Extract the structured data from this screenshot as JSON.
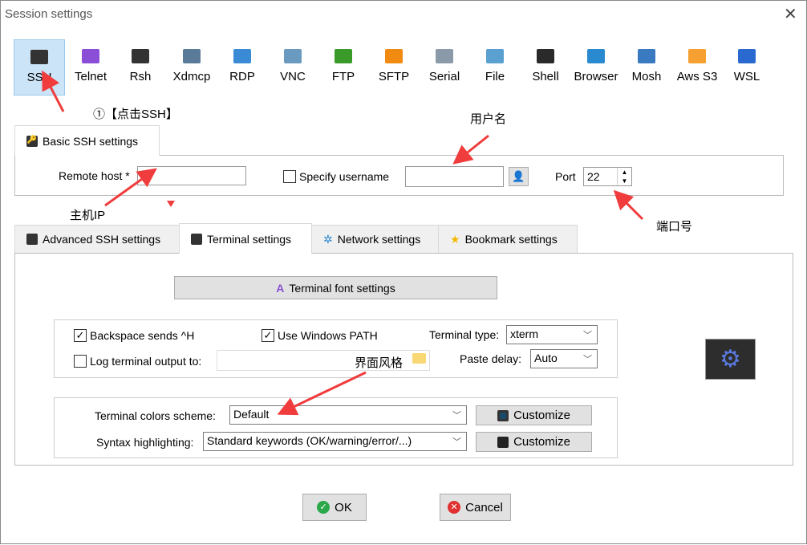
{
  "window": {
    "title": "Session settings",
    "close": "✕"
  },
  "protocols": [
    {
      "label": "SSH",
      "icon": "ssh-key-icon",
      "color": "#333",
      "selected": true
    },
    {
      "label": "Telnet",
      "icon": "telnet-gem-icon",
      "color": "#8a4fd6"
    },
    {
      "label": "Rsh",
      "icon": "rsh-gears-icon",
      "color": "#333"
    },
    {
      "label": "Xdmcp",
      "icon": "xdmcp-monitor-icon",
      "color": "#5a7a9a"
    },
    {
      "label": "RDP",
      "icon": "rdp-monitor-icon",
      "color": "#3a8ad6"
    },
    {
      "label": "VNC",
      "icon": "vnc-monitor-icon",
      "color": "#6a9ac0"
    },
    {
      "label": "FTP",
      "icon": "ftp-globe-icon",
      "color": "#3a9a2a"
    },
    {
      "label": "SFTP",
      "icon": "sftp-globe-icon",
      "color": "#f08a10"
    },
    {
      "label": "Serial",
      "icon": "serial-plug-icon",
      "color": "#8a9aa8"
    },
    {
      "label": "File",
      "icon": "file-monitor-icon",
      "color": "#5aa0d0"
    },
    {
      "label": "Shell",
      "icon": "shell-terminal-icon",
      "color": "#2a2a2a"
    },
    {
      "label": "Browser",
      "icon": "browser-globe-icon",
      "color": "#2a8ad0"
    },
    {
      "label": "Mosh",
      "icon": "mosh-satellite-icon",
      "color": "#3a7ac0"
    },
    {
      "label": "Aws S3",
      "icon": "aws-boxes-icon",
      "color": "#f5a030"
    },
    {
      "label": "WSL",
      "icon": "wsl-windows-icon",
      "color": "#2a6ad0"
    }
  ],
  "basic": {
    "tab": "Basic SSH settings",
    "remote_host_label": "Remote host *",
    "remote_host_value": "",
    "specify_username": "Specify username",
    "specify_username_checked": false,
    "username_value": "",
    "port_label": "Port",
    "port_value": "22"
  },
  "tabs": [
    {
      "label": "Advanced SSH settings",
      "icon": "wrench-icon"
    },
    {
      "label": "Terminal settings",
      "icon": "terminal-icon",
      "active": true
    },
    {
      "label": "Network settings",
      "icon": "network-icon"
    },
    {
      "label": "Bookmark settings",
      "icon": "star-icon"
    }
  ],
  "terminal": {
    "font_button": "Terminal font settings",
    "backspace": "Backspace sends ^H",
    "backspace_checked": true,
    "windows_path": "Use Windows PATH",
    "windows_path_checked": true,
    "terminal_type_label": "Terminal type:",
    "terminal_type": "xterm",
    "log_output": "Log terminal output to:",
    "log_checked": false,
    "log_path": "",
    "paste_delay_label": "Paste delay:",
    "paste_delay": "Auto",
    "colors_label": "Terminal colors scheme:",
    "colors_value": "Default",
    "syntax_label": "Syntax highlighting:",
    "syntax_value": "Standard keywords (OK/warning/error/...)",
    "customize": "Customize"
  },
  "footer": {
    "ok": "OK",
    "cancel": "Cancel"
  },
  "annotations": {
    "click_ssh": "①【点击SSH】",
    "username": "用户名",
    "host_ip": "主机IP",
    "port": "端口号",
    "ui_style": "界面风格"
  },
  "colors": {
    "accent_arrow": "#f03c3c",
    "selected": "#cce4f7"
  }
}
